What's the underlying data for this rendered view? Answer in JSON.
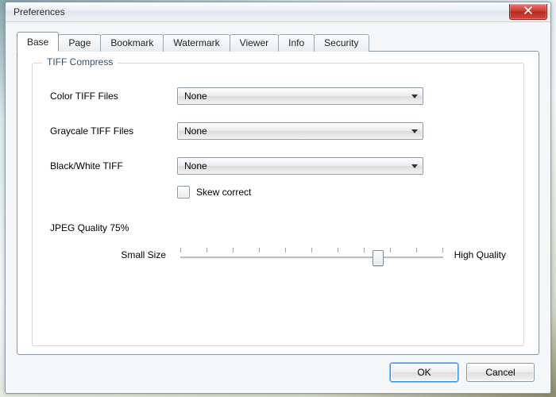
{
  "window": {
    "title": "Preferences"
  },
  "tabs": {
    "items": [
      {
        "label": "Base"
      },
      {
        "label": "Page"
      },
      {
        "label": "Bookmark"
      },
      {
        "label": "Watermark"
      },
      {
        "label": "Viewer"
      },
      {
        "label": "Info"
      },
      {
        "label": "Security"
      }
    ],
    "activeIndex": 0
  },
  "group": {
    "title": "TIFF Compress",
    "colorLabel": "Color TIFF Files",
    "colorValue": "None",
    "grayLabel": "Graycale TIFF Files",
    "grayValue": "None",
    "bwLabel": "Black/White TIFF",
    "bwValue": "None",
    "skewLabel": "Skew correct",
    "skewChecked": false,
    "jpegLabel": "JPEG Quality  75%",
    "sliderLeft": "Small Size",
    "sliderRight": "High Quality",
    "sliderPercent": 75,
    "sliderTicks": 11
  },
  "buttons": {
    "ok": "OK",
    "cancel": "Cancel"
  }
}
